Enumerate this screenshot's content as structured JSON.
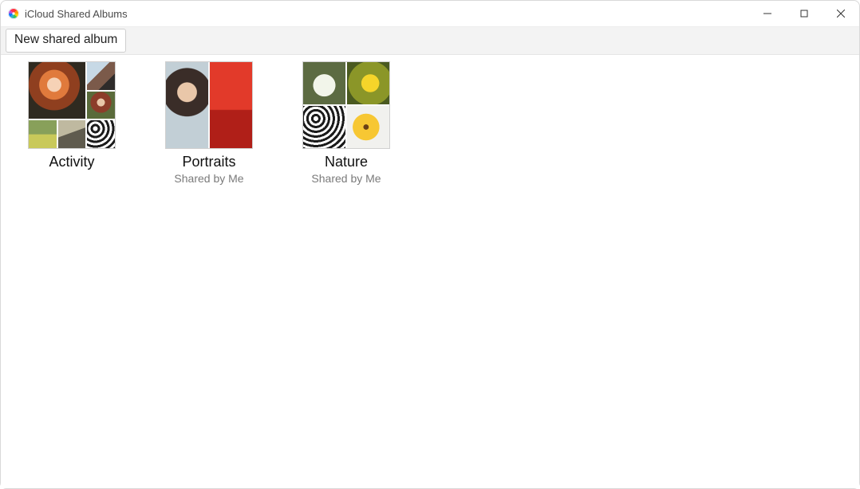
{
  "window": {
    "title": "iCloud Shared Albums"
  },
  "toolbar": {
    "new_shared_album_label": "New shared album"
  },
  "albums": [
    {
      "title": "Activity",
      "subtitle": ""
    },
    {
      "title": "Portraits",
      "subtitle": "Shared by Me"
    },
    {
      "title": "Nature",
      "subtitle": "Shared by Me"
    }
  ]
}
